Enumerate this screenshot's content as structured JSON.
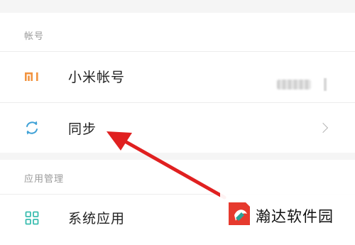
{
  "sections": [
    {
      "header": "帐号",
      "items": [
        {
          "label": "小米帐号",
          "icon": "mi-logo-icon",
          "value_obscured": true
        },
        {
          "label": "同步",
          "icon": "sync-icon",
          "chevron": true
        }
      ]
    },
    {
      "header": "应用管理",
      "items": [
        {
          "label": "系统应用",
          "icon": "grid-apps-icon"
        }
      ]
    }
  ],
  "annotation": {
    "type": "arrow",
    "color": "#e02020",
    "points_to": "同步"
  },
  "watermark": {
    "text": "瀚达软件园",
    "logo_colors": [
      "#e63a2e",
      "#2aa198"
    ]
  },
  "colors": {
    "mi_orange": "#f29440",
    "sync_blue": "#3fa1d6",
    "apps_teal": "#3bbdb0"
  }
}
